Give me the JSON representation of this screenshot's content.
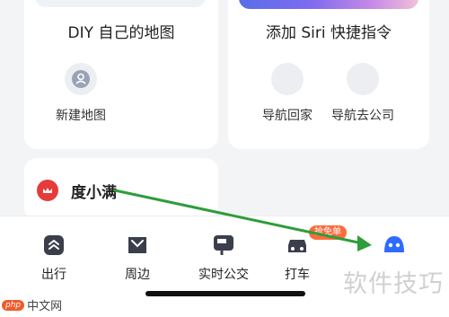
{
  "cards": {
    "diy": {
      "title": "DIY 自己的地图",
      "shortcut_label": "新建地图",
      "shortcut_icon": "user-icon"
    },
    "siri": {
      "title": "添加 Siri 快捷指令",
      "shortcuts": [
        {
          "label": "导航回家"
        },
        {
          "label": "导航去公司"
        }
      ]
    },
    "dxm": {
      "title": "度小满",
      "logo_icon": "dxm-logo-icon"
    }
  },
  "tabbar": {
    "tabs": [
      {
        "label": "出行",
        "icon": "travel-icon"
      },
      {
        "label": "周边",
        "icon": "nearby-icon"
      },
      {
        "label": "实时公交",
        "icon": "bus-icon"
      },
      {
        "label": "打车",
        "icon": "taxi-icon"
      },
      {
        "label": "",
        "icon": "assistant-icon"
      }
    ],
    "badge": "抢免单"
  },
  "watermark": {
    "right_text": "软件技巧",
    "left_brand": "php",
    "left_text": "中文网"
  },
  "colors": {
    "accent": "#2f6bff",
    "annotation": "#2e9d3a",
    "dxm_red": "#e53b3b",
    "badge": "#ff6a3d"
  }
}
